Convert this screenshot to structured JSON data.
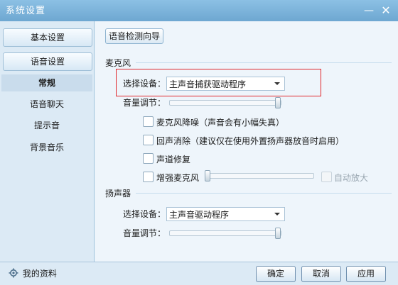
{
  "window": {
    "title": "系统设置"
  },
  "sidebar": {
    "buttons": [
      {
        "label": "基本设置"
      },
      {
        "label": "语音设置"
      }
    ],
    "items": [
      {
        "label": "常规",
        "active": true
      },
      {
        "label": "语音聊天"
      },
      {
        "label": "提示音"
      },
      {
        "label": "背景音乐"
      }
    ]
  },
  "main": {
    "guide_button": "语音检测向导",
    "mic": {
      "title": "麦克风",
      "device_label": "选择设备：",
      "device_value": "主声音捕获驱动程序",
      "volume_label": "音量调节：",
      "volume_level": 0.98,
      "options": [
        {
          "label": "麦克风降噪（声音会有小幅失真）",
          "checked": false
        },
        {
          "label": "回声消除（建议仅在使用外置扬声器放音时启用）",
          "checked": false
        },
        {
          "label": "声道修复",
          "checked": false
        },
        {
          "label": "增强麦克风",
          "checked": false
        }
      ],
      "boost_level": 0.0,
      "auto_amplify": {
        "label": "自动放大",
        "checked": false,
        "disabled": true
      }
    },
    "speaker": {
      "title": "扬声器",
      "device_label": "选择设备：",
      "device_value": "主声音驱动程序",
      "volume_label": "音量调节：",
      "volume_level": 0.98
    }
  },
  "footer": {
    "profile_label": "我的资料",
    "ok_label": "确定",
    "cancel_label": "取消",
    "apply_label": "应用"
  },
  "colors": {
    "titlebar": "#7fb3d8",
    "highlight": "#e0262b"
  }
}
